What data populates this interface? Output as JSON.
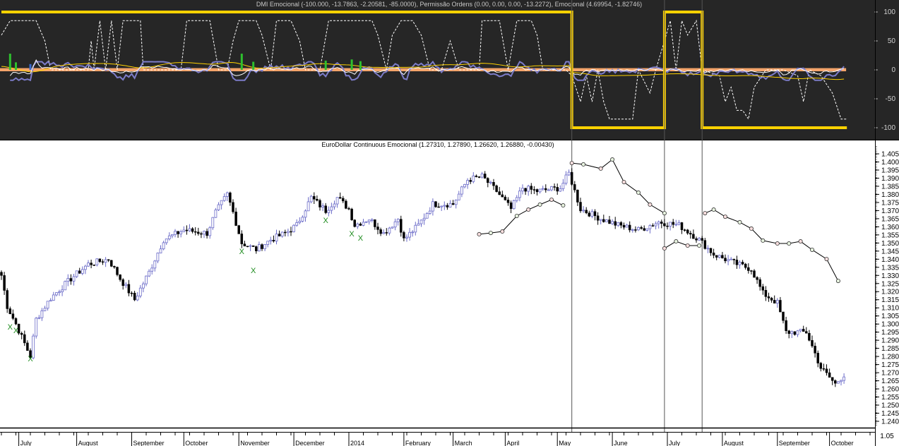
{
  "indicator_panel": {
    "title": "DMI Emocional (-100.000, -13.7863, -2.20581, -85.0000), Permissão Ordens (0.00, 0.00, 0.00, -13.2272), Emocional (4.69954, -1.82746)",
    "y_ticks": [
      "100",
      "50",
      "0",
      "-50",
      "-100"
    ]
  },
  "price_panel": {
    "title": "EuroDollar Continuous Emocional (1.27310, 1.27890, 1.26620, 1.26880, -0.00430)",
    "y_ticks": [
      "1.405",
      "1.400",
      "1.395",
      "1.390",
      "1.385",
      "1.380",
      "1.375",
      "1.370",
      "1.365",
      "1.360",
      "1.355",
      "1.350",
      "1.345",
      "1.340",
      "1.335",
      "1.330",
      "1.325",
      "1.320",
      "1.315",
      "1.310",
      "1.305",
      "1.300",
      "1.295",
      "1.290",
      "1.285",
      "1.280",
      "1.275",
      "1.270",
      "1.265",
      "1.260",
      "1.255",
      "1.250",
      "1.245",
      "1.240"
    ]
  },
  "lower_panel": {
    "tick": "1.05"
  },
  "colors": {
    "panel_bg": "#262626",
    "permission": "#ffd200",
    "dmi": "#ffffff",
    "emocional": "#7c7cc8",
    "band": "#f4a46a",
    "signal": "#2ec02e",
    "up_bar": "#6b6bc8",
    "down_bar": "#000000",
    "marker": "#1a8a1a"
  },
  "chart_data": [
    {
      "type": "line",
      "name": "DMI Emocional / Permissão Ordens",
      "ylim": [
        -100,
        100
      ],
      "x_unit": "bar index",
      "permission_steps": [
        [
          0,
          100
        ],
        [
          197,
          -100
        ],
        [
          229,
          100
        ],
        [
          242,
          -100
        ],
        [
          292,
          -100
        ]
      ],
      "dmi": [
        [
          0,
          60
        ],
        [
          3,
          85
        ],
        [
          12,
          85
        ],
        [
          15,
          50
        ],
        [
          17,
          0
        ],
        [
          30,
          0
        ],
        [
          31,
          50
        ],
        [
          32,
          0
        ],
        [
          34,
          85
        ],
        [
          36,
          0
        ],
        [
          38,
          85
        ],
        [
          40,
          0
        ],
        [
          42,
          85
        ],
        [
          48,
          85
        ],
        [
          49,
          0
        ],
        [
          56,
          0
        ],
        [
          62,
          0
        ],
        [
          64,
          85
        ],
        [
          72,
          85
        ],
        [
          75,
          0
        ],
        [
          78,
          0
        ],
        [
          80,
          50
        ],
        [
          82,
          85
        ],
        [
          88,
          85
        ],
        [
          90,
          60
        ],
        [
          93,
          0
        ],
        [
          95,
          85
        ],
        [
          100,
          85
        ],
        [
          103,
          50
        ],
        [
          105,
          0
        ],
        [
          110,
          0
        ],
        [
          113,
          85
        ],
        [
          128,
          85
        ],
        [
          130,
          60
        ],
        [
          133,
          0
        ],
        [
          135,
          60
        ],
        [
          138,
          85
        ],
        [
          142,
          85
        ],
        [
          145,
          60
        ],
        [
          148,
          0
        ],
        [
          152,
          0
        ],
        [
          155,
          50
        ],
        [
          158,
          0
        ],
        [
          165,
          0
        ],
        [
          166,
          85
        ],
        [
          172,
          85
        ],
        [
          175,
          0
        ],
        [
          178,
          85
        ],
        [
          183,
          85
        ],
        [
          185,
          60
        ],
        [
          187,
          0
        ],
        [
          195,
          0
        ],
        [
          197,
          -10
        ],
        [
          200,
          -55
        ],
        [
          202,
          -10
        ],
        [
          204,
          -55
        ],
        [
          206,
          0
        ],
        [
          208,
          -55
        ],
        [
          210,
          -85
        ],
        [
          218,
          -85
        ],
        [
          220,
          0
        ],
        [
          224,
          -40
        ],
        [
          226,
          0
        ],
        [
          229,
          50
        ],
        [
          231,
          85
        ],
        [
          233,
          0
        ],
        [
          235,
          85
        ],
        [
          237,
          60
        ],
        [
          240,
          85
        ],
        [
          242,
          0
        ],
        [
          248,
          -10
        ],
        [
          250,
          -55
        ],
        [
          252,
          -30
        ],
        [
          254,
          -70
        ],
        [
          256,
          -70
        ],
        [
          258,
          -85
        ],
        [
          260,
          -30
        ],
        [
          264,
          0
        ],
        [
          270,
          0
        ],
        [
          275,
          -10
        ],
        [
          277,
          -55
        ],
        [
          279,
          0
        ],
        [
          283,
          -10
        ],
        [
          287,
          -40
        ],
        [
          290,
          -85
        ],
        [
          292,
          -85
        ]
      ],
      "signal_bars": [
        [
          3,
          28,
          "green"
        ],
        [
          5,
          13,
          "green"
        ],
        [
          10,
          10,
          "blue"
        ],
        [
          83,
          28,
          "green"
        ],
        [
          87,
          14,
          "green"
        ],
        [
          112,
          16,
          "green"
        ],
        [
          121,
          18,
          "green"
        ],
        [
          124,
          15,
          "green"
        ]
      ]
    },
    {
      "type": "candlestick",
      "name": "EuroDollar Continuous",
      "ylim": [
        1.24,
        1.405
      ],
      "close_path": [
        [
          0,
          1.33
        ],
        [
          2,
          1.311
        ],
        [
          5,
          1.3
        ],
        [
          10,
          1.28
        ],
        [
          12,
          1.303
        ],
        [
          17,
          1.316
        ],
        [
          24,
          1.328
        ],
        [
          30,
          1.337
        ],
        [
          37,
          1.34
        ],
        [
          41,
          1.328
        ],
        [
          46,
          1.315
        ],
        [
          51,
          1.332
        ],
        [
          56,
          1.352
        ],
        [
          63,
          1.358
        ],
        [
          71,
          1.356
        ],
        [
          74,
          1.369
        ],
        [
          78,
          1.38
        ],
        [
          80,
          1.369
        ],
        [
          83,
          1.35
        ],
        [
          88,
          1.346
        ],
        [
          93,
          1.352
        ],
        [
          98,
          1.356
        ],
        [
          102,
          1.361
        ],
        [
          107,
          1.378
        ],
        [
          112,
          1.37
        ],
        [
          116,
          1.378
        ],
        [
          120,
          1.371
        ],
        [
          122,
          1.361
        ],
        [
          127,
          1.365
        ],
        [
          132,
          1.356
        ],
        [
          137,
          1.365
        ],
        [
          139,
          1.352
        ],
        [
          144,
          1.361
        ],
        [
          149,
          1.374
        ],
        [
          156,
          1.374
        ],
        [
          161,
          1.389
        ],
        [
          166,
          1.391
        ],
        [
          171,
          1.382
        ],
        [
          176,
          1.371
        ],
        [
          180,
          1.384
        ],
        [
          185,
          1.382
        ],
        [
          193,
          1.384
        ],
        [
          196,
          1.393
        ],
        [
          200,
          1.371
        ],
        [
          207,
          1.365
        ],
        [
          213,
          1.361
        ],
        [
          220,
          1.358
        ],
        [
          227,
          1.363
        ],
        [
          234,
          1.361
        ],
        [
          241,
          1.352
        ],
        [
          246,
          1.343
        ],
        [
          254,
          1.337
        ],
        [
          259,
          1.334
        ],
        [
          263,
          1.319
        ],
        [
          268,
          1.313
        ],
        [
          271,
          1.295
        ],
        [
          278,
          1.295
        ],
        [
          283,
          1.273
        ],
        [
          288,
          1.263
        ],
        [
          291,
          1.2688
        ]
      ],
      "stop_segments": [
        [
          [
            165,
            1.3554
          ],
          [
            169,
            1.3562
          ],
          [
            173,
            1.3571
          ],
          [
            178,
            1.3667
          ],
          [
            182,
            1.3706
          ],
          [
            186,
            1.3737
          ],
          [
            190,
            1.3767
          ],
          [
            194,
            1.3732
          ]
        ],
        [
          [
            197,
            1.3993
          ],
          [
            201,
            1.3985
          ],
          [
            207,
            1.3959
          ],
          [
            211,
            1.4015
          ],
          [
            215,
            1.3876
          ],
          [
            220,
            1.3811
          ],
          [
            224,
            1.3737
          ],
          [
            229,
            1.3684
          ]
        ],
        [
          [
            229,
            1.3467
          ],
          [
            233,
            1.351
          ],
          [
            237,
            1.3484
          ],
          [
            241,
            1.3484
          ]
        ],
        [
          [
            243,
            1.3684
          ],
          [
            246,
            1.3706
          ],
          [
            250,
            1.3662
          ],
          [
            255,
            1.3628
          ],
          [
            259,
            1.3589
          ],
          [
            263,
            1.3515
          ],
          [
            268,
            1.3497
          ],
          [
            272,
            1.3497
          ],
          [
            276,
            1.351
          ],
          [
            280,
            1.3458
          ],
          [
            285,
            1.3401
          ],
          [
            289,
            1.3266
          ]
        ]
      ],
      "x_markers": [
        [
          3,
          1.2983
        ],
        [
          5,
          1.2962
        ],
        [
          10,
          1.2788
        ],
        [
          83,
          1.3449
        ],
        [
          87,
          1.3332
        ],
        [
          112,
          1.3641
        ],
        [
          121,
          1.3558
        ],
        [
          124,
          1.3532
        ]
      ],
      "x_marker_label": "X",
      "vertical_lines": [
        197,
        229,
        242
      ],
      "months": [
        [
          "July",
          6
        ],
        [
          "August",
          26
        ],
        [
          "September",
          45
        ],
        [
          "October",
          63
        ],
        [
          "November",
          82
        ],
        [
          "December",
          101
        ],
        [
          "2014",
          120
        ],
        [
          "February",
          139
        ],
        [
          "March",
          156
        ],
        [
          "April",
          174
        ],
        [
          "May",
          192
        ],
        [
          "June",
          211
        ],
        [
          "July",
          230
        ],
        [
          "August",
          249
        ],
        [
          "September",
          268
        ],
        [
          "October",
          286
        ]
      ]
    }
  ]
}
